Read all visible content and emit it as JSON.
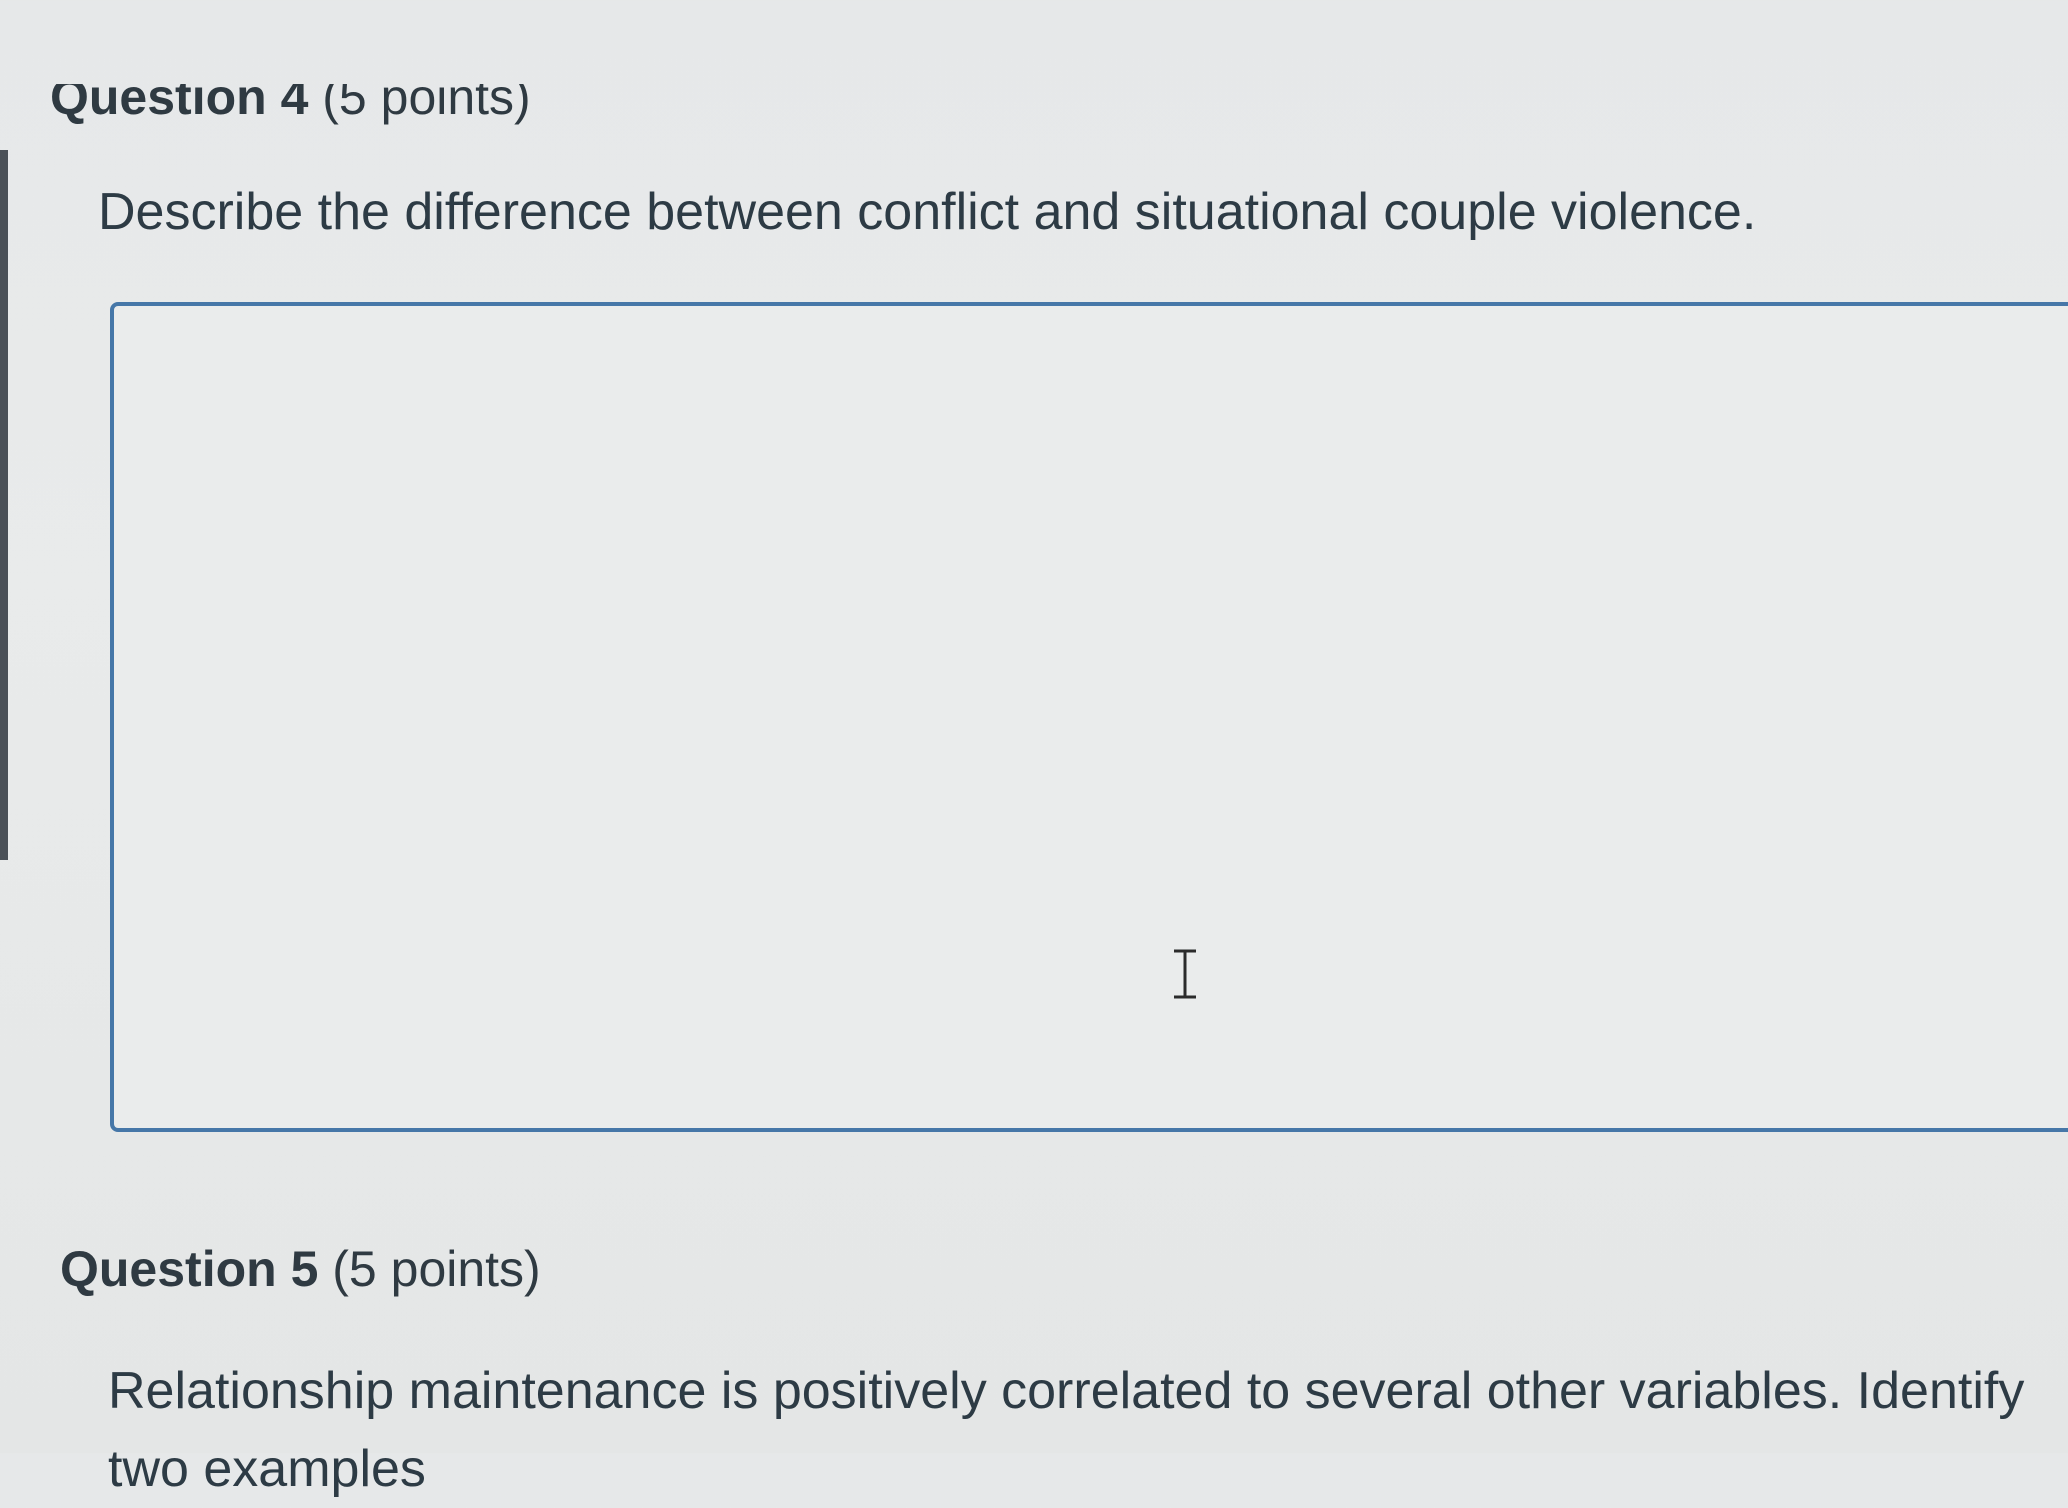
{
  "question4": {
    "heading": "Question 4",
    "points": "(5 points)",
    "text": "Describe the difference between conflict and situational couple violence.",
    "answer": ""
  },
  "question5": {
    "heading": "Question 5",
    "points": "(5 points)",
    "text_line1": "Relationship maintenance is positively correlated to several other variables.  Identify",
    "text_line2": "two examples"
  },
  "icons": {
    "cursor": "text-cursor-icon"
  },
  "colors": {
    "background": "#e8eaea",
    "text": "#2d3b45",
    "focus_border": "#4677a8"
  }
}
